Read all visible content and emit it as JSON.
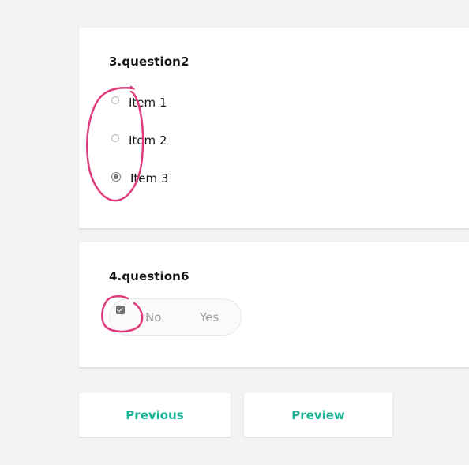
{
  "question3": {
    "title": "3.question2",
    "options": [
      {
        "label": "Item 1",
        "checked": false
      },
      {
        "label": "Item 2",
        "checked": false
      },
      {
        "label": "Item 3",
        "checked": true
      }
    ]
  },
  "question4": {
    "title": "4.question6",
    "checkbox_checked": true,
    "no_label": "No",
    "yes_label": "Yes"
  },
  "navigation": {
    "previous_label": "Previous",
    "preview_label": "Preview"
  },
  "colors": {
    "accent": "#19b394",
    "annotation": "#e03a7c",
    "background": "#f3f3f3"
  },
  "icons": {
    "radio": "radio-button-icon",
    "checkbox": "checkbox-checked-icon"
  }
}
